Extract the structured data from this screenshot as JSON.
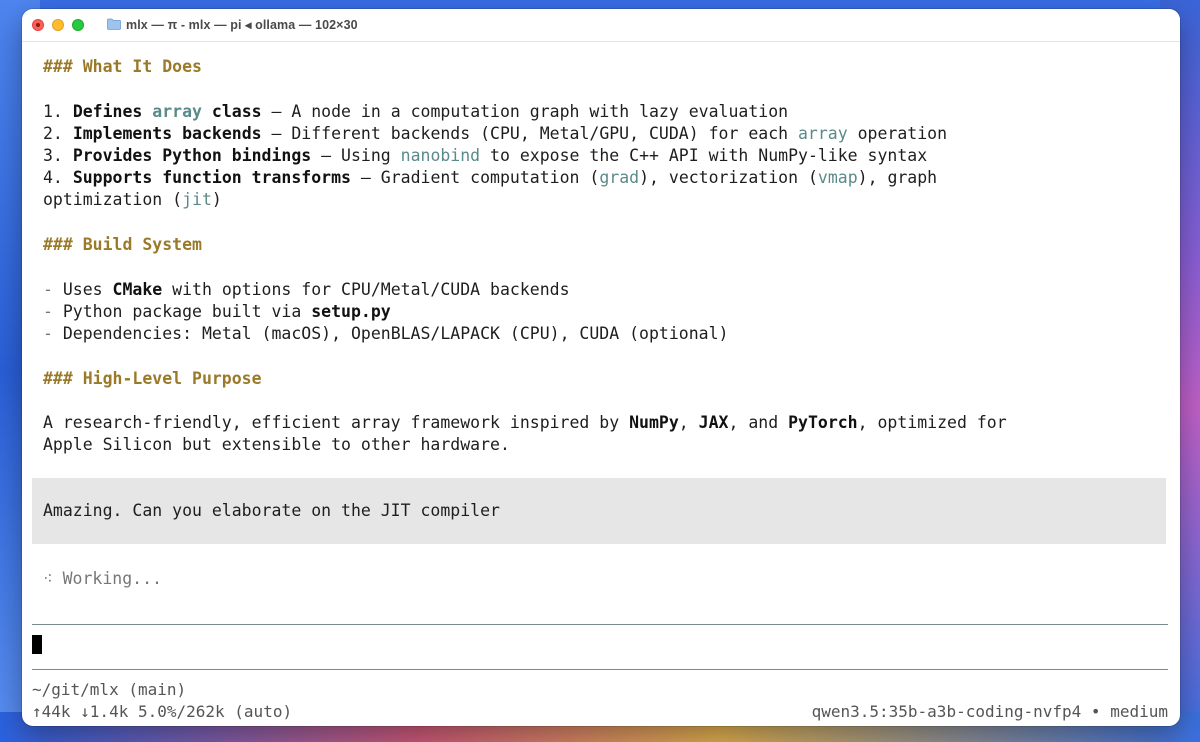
{
  "window": {
    "title": "mlx — π - mlx — pi ◂ ollama — 102×30"
  },
  "sections": {
    "what_it_does": {
      "heading": "### What It Does",
      "items": [
        {
          "num": "1. ",
          "b1": "Defines ",
          "code": "array",
          "b2": " class",
          "rest": " – A node in a computation graph with lazy evaluation"
        },
        {
          "num": "2. ",
          "b1": "Implements backends",
          "rest1": " – Different backends (CPU, Metal/GPU, CUDA) for each ",
          "code": "array",
          "rest2": " operation"
        },
        {
          "num": "3. ",
          "b1": "Provides Python bindings",
          "rest1": " – Using ",
          "code": "nanobind",
          "rest2": " to expose the C++ API with NumPy-like syntax"
        },
        {
          "num": "4. ",
          "b1": "Supports function transforms",
          "rest1": " – Gradient computation (",
          "code1": "grad",
          "rest2": "), vectorization (",
          "code2": "vmap",
          "rest3": "), graph",
          "cont1": "optimization (",
          "code3": "jit",
          "cont2": ")"
        }
      ]
    },
    "build_system": {
      "heading": "### Build System",
      "items": [
        {
          "dash": "- ",
          "t1": "Uses ",
          "b": "CMake",
          "t2": " with options for CPU/Metal/CUDA backends"
        },
        {
          "dash": "- ",
          "t1": "Python package built via ",
          "b": "setup.py",
          "t2": ""
        },
        {
          "dash": "- ",
          "t1": "Dependencies: Metal (macOS), OpenBLAS/LAPACK (CPU), CUDA (optional)",
          "b": "",
          "t2": ""
        }
      ]
    },
    "purpose": {
      "heading": "### High-Level Purpose",
      "p1": "A research-friendly, efficient array framework inspired by ",
      "b1": "NumPy",
      "p2": ", ",
      "b2": "JAX",
      "p3": ", and ",
      "b3": "PyTorch",
      "p4": ", optimized for",
      "line2": "Apple Silicon but extensible to other hardware."
    }
  },
  "user_prompt": "Amazing. Can you elaborate on the JIT compiler",
  "working": {
    "spinner": "⁖",
    "text": " Working..."
  },
  "status": {
    "cwd": "~/git/mlx (main)",
    "tokens": "↑44k ↓1.4k 5.0%/262k (auto)",
    "model": "qwen3.5:35b-a3b-coding-nvfp4 • medium"
  }
}
